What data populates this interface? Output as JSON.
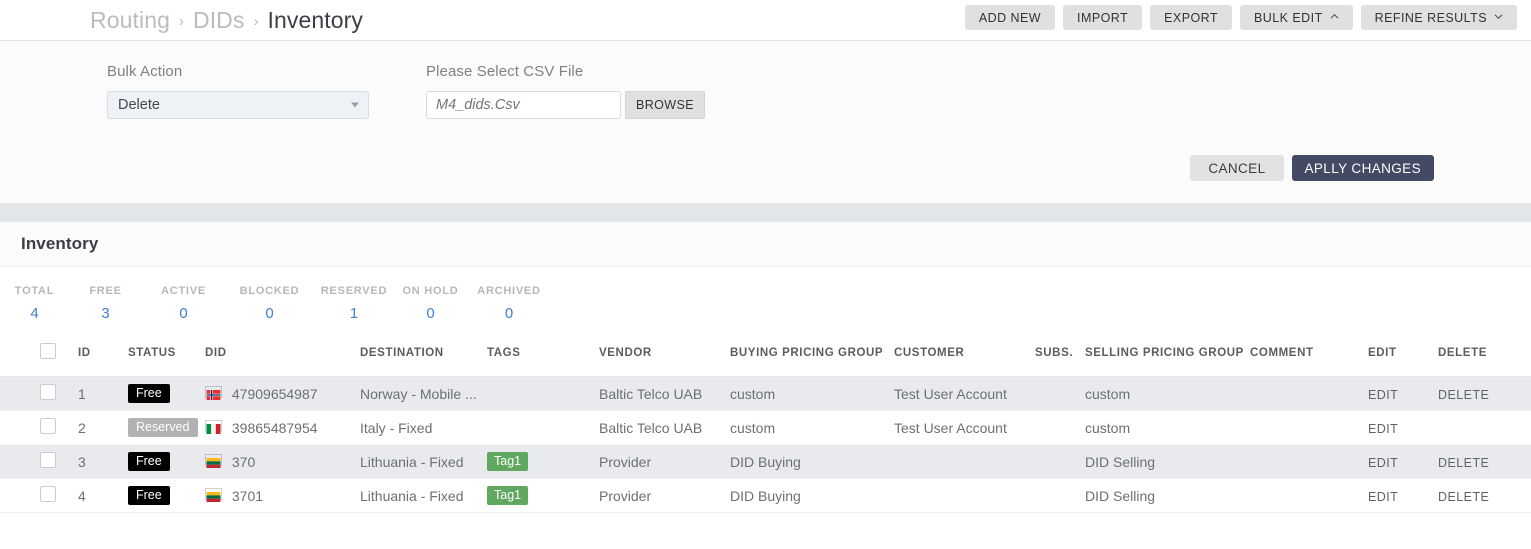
{
  "breadcrumb": {
    "items": [
      {
        "label": "Routing",
        "active": false
      },
      {
        "label": "DIDs",
        "active": false
      },
      {
        "label": "Inventory",
        "active": true
      }
    ],
    "separator": "›"
  },
  "toolbar": {
    "add_new": "ADD NEW",
    "import": "IMPORT",
    "export": "EXPORT",
    "bulk_edit": "BULK EDIT",
    "refine_results": "REFINE RESULTS"
  },
  "bulk_panel": {
    "bulk_action_label": "Bulk Action",
    "bulk_action_value": "Delete",
    "bulk_action_options": [
      "Delete"
    ],
    "csv_label": "Please Select CSV File",
    "csv_placeholder": "M4_dids.Csv",
    "csv_value": "",
    "browse_label": "BROWSE",
    "cancel_label": "CANCEL",
    "apply_label": "APLLY CHANGES"
  },
  "section": {
    "title": "Inventory"
  },
  "stats": [
    {
      "label": "TOTAL",
      "value": "4"
    },
    {
      "label": "FREE",
      "value": "3"
    },
    {
      "label": "ACTIVE",
      "value": "0"
    },
    {
      "label": "BLOCKED",
      "value": "0"
    },
    {
      "label": "RESERVED",
      "value": "1"
    },
    {
      "label": "ON HOLD",
      "value": "0"
    },
    {
      "label": "ARCHIVED",
      "value": "0"
    }
  ],
  "table": {
    "headers": {
      "id": "ID",
      "status": "STATUS",
      "did": "DID",
      "destination": "DESTINATION",
      "tags": "TAGS",
      "vendor": "VENDOR",
      "buying_pricing_group": "BUYING PRICING GROUP",
      "customer": "CUSTOMER",
      "subs": "SUBS.",
      "selling_pricing_group": "SELLING PRICING GROUP",
      "comment": "COMMENT",
      "edit": "EDIT",
      "delete": "DELETE"
    },
    "rows": [
      {
        "id": "1",
        "status": "Free",
        "status_kind": "free",
        "flag": "norway-flag-icon",
        "did": "47909654987",
        "destination": "Norway - Mobile ...",
        "tags": "",
        "vendor": "Baltic Telco UAB",
        "buying_pricing_group": "custom",
        "customer": "Test User Account",
        "subs": "",
        "selling_pricing_group": "custom",
        "comment": "",
        "edit": "EDIT",
        "delete": "DELETE"
      },
      {
        "id": "2",
        "status": "Reserved",
        "status_kind": "reserved",
        "flag": "italy-flag-icon",
        "did": "39865487954",
        "destination": "Italy - Fixed",
        "tags": "",
        "vendor": "Baltic Telco UAB",
        "buying_pricing_group": "custom",
        "customer": "Test User Account",
        "subs": "",
        "selling_pricing_group": "custom",
        "comment": "",
        "edit": "EDIT",
        "delete": ""
      },
      {
        "id": "3",
        "status": "Free",
        "status_kind": "free",
        "flag": "lithuania-flag-icon",
        "did": "370",
        "destination": "Lithuania - Fixed",
        "tags": "Tag1",
        "vendor": "Provider",
        "buying_pricing_group": "DID Buying",
        "customer": "",
        "subs": "",
        "selling_pricing_group": "DID Selling",
        "comment": "",
        "edit": "EDIT",
        "delete": "DELETE"
      },
      {
        "id": "4",
        "status": "Free",
        "status_kind": "free",
        "flag": "lithuania-flag-icon",
        "did": "3701",
        "destination": "Lithuania - Fixed",
        "tags": "Tag1",
        "vendor": "Provider",
        "buying_pricing_group": "DID Buying",
        "customer": "",
        "subs": "",
        "selling_pricing_group": "DID Selling",
        "comment": "",
        "edit": "EDIT",
        "delete": "DELETE"
      }
    ]
  },
  "colors": {
    "accent_link": "#3f7fd6",
    "apply_button": "#434a63",
    "tag_green": "#60a860",
    "badge_free": "#000000",
    "badge_reserved": "#b2b2b2",
    "row_stripe": "#e8eaed"
  }
}
